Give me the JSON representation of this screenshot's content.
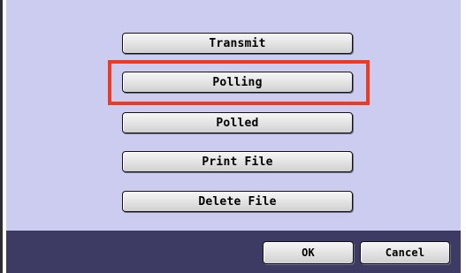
{
  "menu": {
    "items": [
      {
        "label": "Transmit"
      },
      {
        "label": "Polling"
      },
      {
        "label": "Polled"
      },
      {
        "label": "Print File"
      },
      {
        "label": "Delete File"
      }
    ],
    "highlighted_item": "Polling"
  },
  "footer": {
    "ok_label": "OK",
    "cancel_label": "Cancel"
  },
  "colors": {
    "panel_background": "#ccccf0",
    "footer_background": "#3d3b63",
    "highlight_border": "#ee3b1f",
    "button_border": "#111111"
  }
}
